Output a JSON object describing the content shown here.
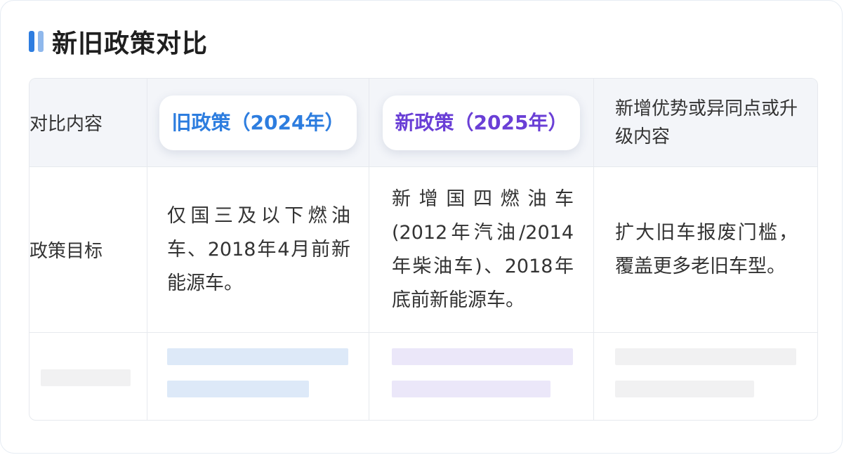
{
  "title": "新旧政策对比",
  "table": {
    "headers": {
      "col0": "对比内容",
      "col1": "旧政策（2024年）",
      "col2": "新政策（2025年）",
      "col3": "新增优势或异同点或升级内容"
    },
    "rows": [
      {
        "label": "政策目标",
        "old": "仅国三及以下燃油车、2018年4月前新能源车。",
        "new": "新增国四燃油车(2012年汽油/2014年柴油车)、2018年底前新能源车。",
        "diff": "扩大旧车报废门槛，覆盖更多老旧车型。"
      }
    ]
  },
  "colors": {
    "old_accent": "#2d7ddf",
    "new_accent": "#6a3fd6",
    "placeholder_old": "#dde9f8",
    "placeholder_new": "#ebe7f9",
    "placeholder_gray": "#f1f1f2"
  }
}
